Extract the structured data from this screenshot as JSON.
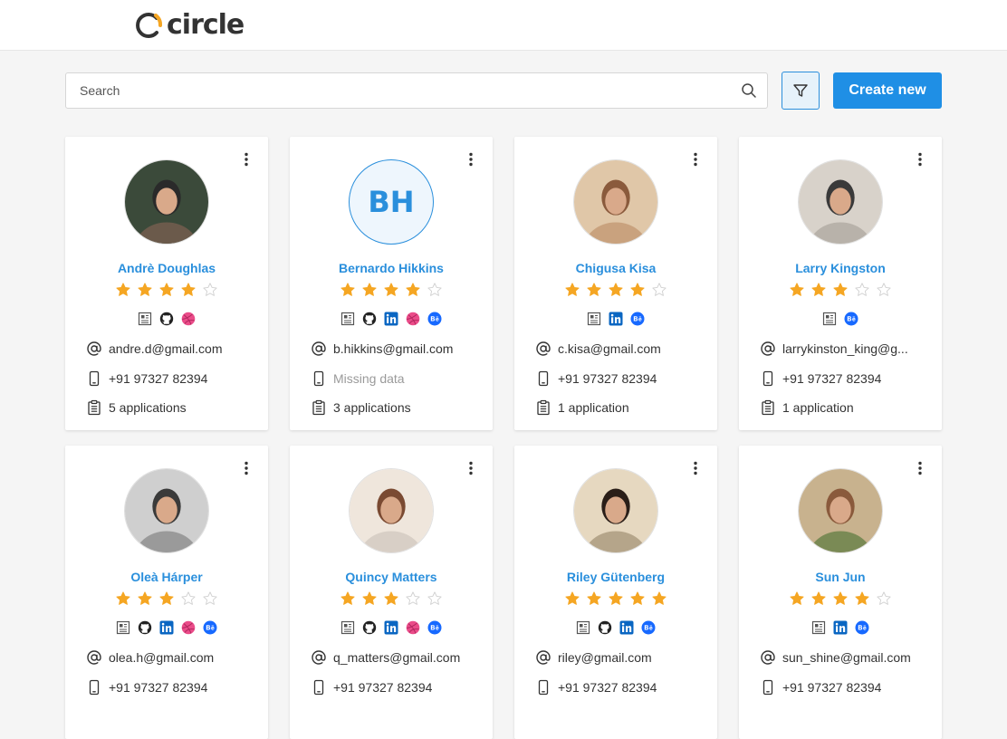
{
  "app": {
    "logo_text": "circle"
  },
  "toolbar": {
    "search_placeholder": "Search",
    "create_label": "Create new"
  },
  "colors": {
    "accent": "#1f8fe5",
    "link": "#2a8fdc",
    "star_filled": "#f5a623",
    "star_empty": "#cfcfcf",
    "linkedin": "#0a66c2",
    "dribbble": "#ea4c89",
    "behance": "#1769ff"
  },
  "candidates": [
    {
      "name": "Andrè Doughlas",
      "rating": 4,
      "avatar": "photo",
      "initials": "",
      "socials": [
        "resume-icon",
        "github-icon",
        "dribbble-icon"
      ],
      "email": "andre.d@gmail.com",
      "phone": "+91 97327 82394",
      "applications": "5 applications"
    },
    {
      "name": "Bernardo Hikkins",
      "rating": 4,
      "avatar": "initials",
      "initials": "BH",
      "socials": [
        "resume-icon",
        "github-icon",
        "linkedin-icon",
        "dribbble-icon",
        "behance-icon"
      ],
      "email": "b.hikkins@gmail.com",
      "phone": "Missing data",
      "phone_missing": true,
      "applications": "3 applications"
    },
    {
      "name": "Chigusa Kisa",
      "rating": 4,
      "avatar": "photo",
      "initials": "",
      "socials": [
        "resume-icon",
        "linkedin-icon",
        "behance-icon"
      ],
      "email": "c.kisa@gmail.com",
      "phone": "+91 97327 82394",
      "applications": "1 application"
    },
    {
      "name": "Larry Kingston",
      "rating": 3,
      "avatar": "photo",
      "initials": "",
      "socials": [
        "resume-icon",
        "behance-icon"
      ],
      "email": "larrykinston_king@g...",
      "phone": "+91 97327 82394",
      "applications": "1 application"
    },
    {
      "name": "Oleà Hárper",
      "rating": 3,
      "avatar": "photo",
      "initials": "",
      "socials": [
        "resume-icon",
        "github-icon",
        "linkedin-icon",
        "dribbble-icon",
        "behance-icon"
      ],
      "email": "olea.h@gmail.com",
      "phone": "+91 97327 82394",
      "applications": ""
    },
    {
      "name": "Quincy Matters",
      "rating": 3,
      "avatar": "photo",
      "initials": "",
      "socials": [
        "resume-icon",
        "github-icon",
        "linkedin-icon",
        "dribbble-icon",
        "behance-icon"
      ],
      "email": "q_matters@gmail.com",
      "phone": "+91 97327 82394",
      "applications": ""
    },
    {
      "name": "Riley Gütenberg",
      "rating": 5,
      "avatar": "photo",
      "initials": "",
      "socials": [
        "resume-icon",
        "github-icon",
        "linkedin-icon",
        "behance-icon"
      ],
      "email": "riley@gmail.com",
      "phone": "+91 97327 82394",
      "applications": ""
    },
    {
      "name": "Sun Jun",
      "rating": 4,
      "avatar": "photo",
      "initials": "",
      "socials": [
        "resume-icon",
        "linkedin-icon",
        "behance-icon"
      ],
      "email": "sun_shine@gmail.com",
      "phone": "+91 97327 82394",
      "applications": ""
    }
  ]
}
